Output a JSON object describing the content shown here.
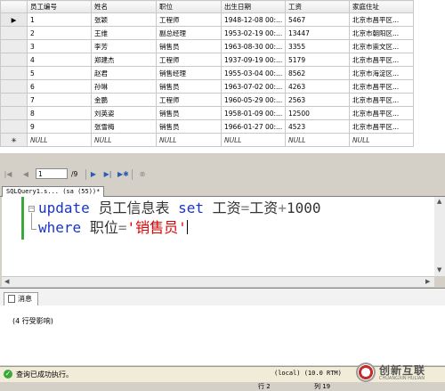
{
  "grid": {
    "columns": [
      "员工编号",
      "姓名",
      "职位",
      "出生日期",
      "工资",
      "家庭住址"
    ],
    "rows": [
      [
        "1",
        "张颖",
        "工程师",
        "1948-12-08 00:...",
        "5467",
        "北京市昌平区..."
      ],
      [
        "2",
        "王维",
        "副总经理",
        "1953-02-19 00:...",
        "13447",
        "北京市朝阳区..."
      ],
      [
        "3",
        "李芳",
        "销售员",
        "1963-08-30 00:...",
        "3355",
        "北京市崇文区..."
      ],
      [
        "4",
        "郑建杰",
        "工程师",
        "1937-09-19 00:...",
        "5179",
        "北京市昌平区..."
      ],
      [
        "5",
        "赵君",
        "销售经理",
        "1955-03-04 00:...",
        "8562",
        "北京市海淀区..."
      ],
      [
        "6",
        "孙琳",
        "销售员",
        "1963-07-02 00:...",
        "4263",
        "北京市昌平区..."
      ],
      [
        "7",
        "金鹏",
        "工程师",
        "1960-05-29 00:...",
        "2563",
        "北京市昌平区..."
      ],
      [
        "8",
        "刘英姿",
        "销售员",
        "1958-01-09 00:...",
        "12500",
        "北京市昌平区..."
      ],
      [
        "9",
        "张雪梅",
        "销售员",
        "1966-01-27 00:...",
        "4523",
        "北京市昌平区..."
      ]
    ],
    "null_text": "NULL",
    "current_row_marker": "▶",
    "new_row_marker": "✳"
  },
  "nav": {
    "position": "1",
    "total": "/9"
  },
  "query_tab": {
    "label": "SQLQuery1.s... (sa (55))*"
  },
  "editor": {
    "line1": {
      "kw1": "update",
      "sp1": " ",
      "table": "员工信息表",
      "sp2": " ",
      "kw2": "set",
      "sp3": " ",
      "col1": "工资",
      "eq1": "=",
      "col2": "工资",
      "plus": "+",
      "num": "1000"
    },
    "line2": {
      "kw": "where",
      "sp": " ",
      "col": "职位",
      "eq": "=",
      "str": "'销售员'"
    }
  },
  "messages": {
    "tab_label": "消息",
    "text": "(4 行受影响)"
  },
  "status": {
    "message": "查询已成功执行。",
    "server": "(local) (10.0 RTM)",
    "row_label": "行 2",
    "col_label": "列 19"
  },
  "watermark": {
    "brand": "创新互联",
    "sub": "CHUANGXIN HULIAN"
  },
  "colors": {
    "keyword": "#1a34c8",
    "string": "#e00000",
    "operator": "#808080",
    "status_bg": "#f0ecd8",
    "success": "#3aa83a"
  }
}
